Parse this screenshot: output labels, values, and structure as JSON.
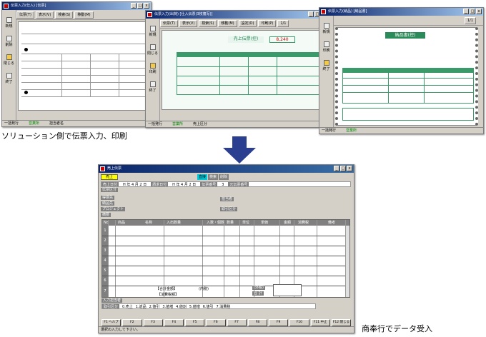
{
  "captions": {
    "top": "ソリューション側で伝票入力、印刷",
    "bottom": "商奉行でデータ受入"
  },
  "win1": {
    "title": "伝票入力(仕入)  [伝票]",
    "toolbar": [
      "伝票(T)",
      "表示(V)",
      "検索(S)",
      "移動(M)",
      "設定(O)",
      "印刷(P)"
    ],
    "side": [
      "新規",
      "削除",
      "閉じる",
      "終了"
    ],
    "status": [
      "一括発行",
      "営業所",
      "担当者名"
    ]
  },
  "win2": {
    "title": "伝票入力(出荷)  [仕入伝票(3枚複写)]",
    "toolbar": [
      "伝票(T)",
      "表示(V)",
      "検索(S)",
      "移動(M)",
      "設定(O)",
      "印刷(P)"
    ],
    "page": "1/1",
    "side": [
      "新規",
      "閉じる",
      "印刷",
      "終了"
    ],
    "form_title": "売上伝票(控)",
    "amount": "8,240",
    "status": [
      "一括発行",
      "営業所",
      "売上区分"
    ]
  },
  "win3": {
    "title": "伝票入力(納品)  [納品書]",
    "page": "1/1",
    "side": [
      "新規",
      "印刷",
      "終了"
    ],
    "form_title": "納品書(控)",
    "status": [
      "一括発行",
      "営業所"
    ]
  },
  "main": {
    "title": "売上伝票",
    "mode": "売上",
    "tabs": [
      "直接",
      "検索",
      "削除"
    ],
    "row1": {
      "label": "売上日付",
      "date": "H 年 4 月 2 日",
      "label2": "請求日付",
      "date2": "H 年 4 月 2 日",
      "label3": "伝票番号",
      "num": "3",
      "label4": "元伝票番号"
    },
    "row2": {
      "label": "伝票区分"
    },
    "fields_left": [
      "得意先",
      "納品先",
      "プロジェクト",
      "摘要"
    ],
    "fields_right": [
      "担当者",
      "取引区分"
    ],
    "grid_headers": [
      "No",
      "商品",
      "名称",
      "入出数量",
      "入数・個数",
      "数量",
      "単位",
      "単価",
      "金額",
      "消費税",
      "備考"
    ],
    "row_numbers": [
      "1",
      "2",
      "3",
      "4",
      "5",
      "6",
      "7"
    ],
    "footer": {
      "total_label": "【合計金額】",
      "tax_label": "(内税)",
      "total2": "【消費税額】",
      "side_label": "(外税)",
      "side_label2": "合 計",
      "info_label": "入力担当者",
      "info2": "取引区分",
      "opts": [
        "0.売上",
        "1.返品",
        "2.値引",
        "3.値増",
        "4.値割",
        "5.値増",
        "6.値引",
        "7.消費税"
      ]
    },
    "fkeys": [
      "F1 ヘルプ",
      "F2",
      "F3",
      "F4",
      "F5",
      "F6",
      "F7",
      "F8",
      "F9",
      "F10",
      "F11 中止",
      "F12 閉じる"
    ],
    "status": "選択の入力して下さい。"
  }
}
